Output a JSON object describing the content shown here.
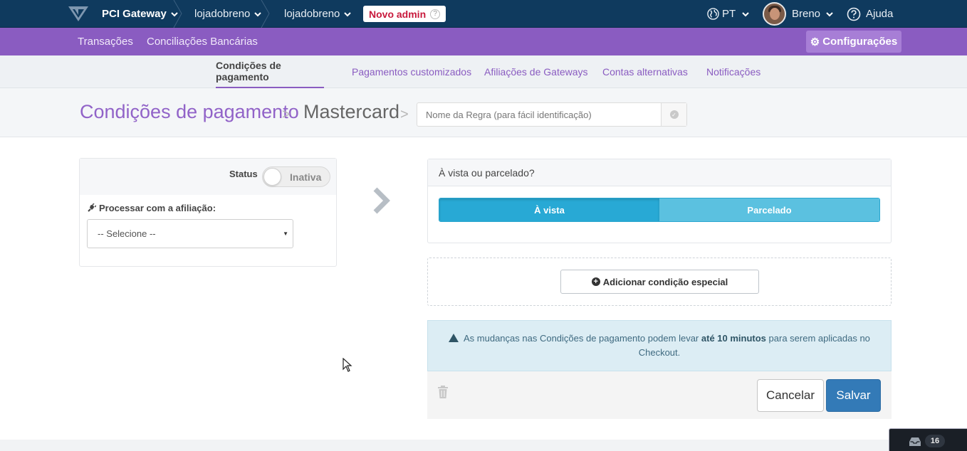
{
  "topbar": {
    "brand": "PCI Gateway",
    "account1": "lojadobreno",
    "account2": "lojadobreno",
    "admin_badge": "Novo admin",
    "admin_badge_help": "?",
    "language": "PT",
    "user_name": "Breno",
    "help": "Ajuda"
  },
  "purplebar": {
    "links": [
      "Transações",
      "Conciliações Bancárias"
    ],
    "config_label": "Configurações"
  },
  "subnav": {
    "tabs": [
      {
        "label": "Condições de pagamento",
        "active": true
      },
      {
        "label": "Pagamentos customizados",
        "active": false
      },
      {
        "label": "Afiliações de Gateways",
        "active": false
      },
      {
        "label": "Contas alternativas",
        "active": false
      },
      {
        "label": "Notificações",
        "active": false
      }
    ]
  },
  "header": {
    "crumb1": "Condições de pagamento",
    "sep": ">",
    "crumb2": "Mastercard",
    "rule_placeholder": "Nome da Regra (para fácil identificação)",
    "rule_value": ""
  },
  "left_panel": {
    "status_label": "Status",
    "status_value": "Inativa",
    "process_label": "Processar com a afiliação:",
    "select_value": "-- Selecione --"
  },
  "payment_panel": {
    "title": "À vista ou parcelado?",
    "options": [
      "À vista",
      "Parcelado"
    ],
    "selected": "À vista"
  },
  "special": {
    "add_label": "Adicionar condição especial"
  },
  "alert": {
    "part1": "As mudanças nas Condições de pagamento podem levar",
    "bold": "até 10 minutos",
    "part2": "para serem aplicadas no Checkout."
  },
  "actions": {
    "cancel": "Cancelar",
    "save": "Salvar"
  },
  "inbox": {
    "count": "16"
  },
  "colors": {
    "topbar": "#0f3a5e",
    "purple": "#8a5cc1",
    "primary": "#337ab7",
    "segment_active": "#28a9d5",
    "segment_inactive": "#5bc1e0",
    "alert_bg": "#dcedf4"
  }
}
